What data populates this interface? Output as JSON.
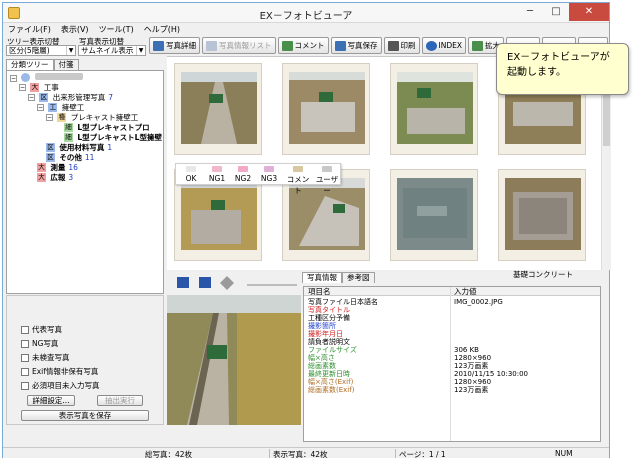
{
  "window": {
    "title": "EX－フォトビューア",
    "minimize": "─",
    "maximize": "□",
    "close": "✕"
  },
  "menu": [
    "ファイル(F)",
    "表示(V)",
    "ツール(T)",
    "ヘルプ(H)"
  ],
  "left_controls": {
    "tree_label": "ツリー表示切替",
    "tree_value": "区分(5階層)",
    "photo_label": "写真表示切替",
    "photo_value": "サムネイル表示"
  },
  "toolbar": [
    {
      "label": "写真詳細",
      "disabled": false,
      "icon_color": "#3d6fb5"
    },
    {
      "label": "写真情報リスト",
      "disabled": true,
      "icon_color": "#b8c4d6"
    },
    {
      "label": "コメント",
      "disabled": false,
      "icon_color": "#4a8f4a"
    },
    {
      "label": "写真保存",
      "disabled": false,
      "icon_color": "#3d6fb5"
    },
    {
      "label": "印刷",
      "disabled": false,
      "icon_color": "#555555"
    },
    {
      "label": "INDEX",
      "disabled": false,
      "icon_color": "#2b66b8"
    },
    {
      "label": "拡大",
      "disabled": false,
      "icon_color": "#4a8f4a"
    }
  ],
  "left_tabs": [
    "分類ツリー",
    "付箋"
  ],
  "tree": [
    {
      "tag": "大",
      "tag_color": "#f0a0a0",
      "label": "工事",
      "count": ""
    },
    {
      "tag": "区",
      "tag_color": "#9ab8e8",
      "label": "出来形管理写真",
      "count": "7"
    },
    {
      "tag": "工",
      "tag_color": "#9ab8e8",
      "label": "擁壁工",
      "count": ""
    },
    {
      "tag": "種",
      "tag_color": "#f2d79a",
      "label": "プレキャスト擁壁工",
      "count": ""
    },
    {
      "tag": "細",
      "tag_color": "#a8d8a0",
      "label": "L型プレキャストプロ",
      "count": ""
    },
    {
      "tag": "細",
      "tag_color": "#a8d8a0",
      "label": "L型プレキャストL型擁壁",
      "count": ""
    },
    {
      "tag": "区",
      "tag_color": "#9ab8e8",
      "label": "使用材料写真",
      "count": "1"
    },
    {
      "tag": "区",
      "tag_color": "#9ab8e8",
      "label": "その他",
      "count": "11"
    },
    {
      "tag": "大",
      "tag_color": "#f0a0a0",
      "label": "測量",
      "count": "16"
    },
    {
      "tag": "大",
      "tag_color": "#f0a0a0",
      "label": "広報",
      "count": "3"
    }
  ],
  "filters": [
    "代表写真",
    "NG写真",
    "未検査写真",
    "Exif情報非保有写真",
    "必須項目未入力写真"
  ],
  "filter_buttons": {
    "detail": "詳細設定...",
    "extract": "抽出実行",
    "save": "表示写真を保存"
  },
  "flags": [
    {
      "label": "OK",
      "color": "#e8e8e8"
    },
    {
      "label": "NG1",
      "color": "#f0b8c8"
    },
    {
      "label": "NG2",
      "color": "#f3a8c6"
    },
    {
      "label": "NG3",
      "color": "#e0b0d8"
    },
    {
      "label": "コメント",
      "color": "#d8c8a0"
    },
    {
      "label": "ユーザー",
      "color": "#c8c8c8"
    }
  ],
  "thumbnail_caption": "基礎コンクリート",
  "tooltip": {
    "line1": "EX－フォトビューアが",
    "line2": "起動します。"
  },
  "info_tabs": [
    "写真情報",
    "参考図"
  ],
  "info_table": {
    "head_name": "項目名",
    "head_value": "入力値",
    "rows": [
      {
        "key": "写真ファイル日本語名",
        "value": "IMG_0002.JPG",
        "color": "#000000"
      },
      {
        "key": "写真タイトル",
        "value": "",
        "color": "#d02020"
      },
      {
        "key": "工種区分予備",
        "value": "",
        "color": "#000000"
      },
      {
        "key": "撮影箇所",
        "value": "",
        "color": "#1f3fd0"
      },
      {
        "key": "撮影年月日",
        "value": "",
        "color": "#d02020"
      },
      {
        "key": "請負者説明文",
        "value": "",
        "color": "#000000"
      },
      {
        "key": "ファイルサイズ",
        "value": "306 KB",
        "color": "#2a8f2a"
      },
      {
        "key": "幅×高さ",
        "value": "1280×960",
        "color": "#2a8f2a"
      },
      {
        "key": "総画素数",
        "value": "123万画素",
        "color": "#2a8f2a"
      },
      {
        "key": "最終更新日時",
        "value": "2010/11/15 10:30:00",
        "color": "#2a8f2a"
      },
      {
        "key": "幅×高さ(Exif)",
        "value": "1280×960",
        "color": "#b06a20"
      },
      {
        "key": "総画素数(Exif)",
        "value": "123万画素",
        "color": "#b06a20"
      }
    ]
  },
  "status": {
    "total": "総写真：42枚",
    "shown": "表示写真：42枚",
    "page": "ページ：1 / 1",
    "num": "NUM"
  }
}
